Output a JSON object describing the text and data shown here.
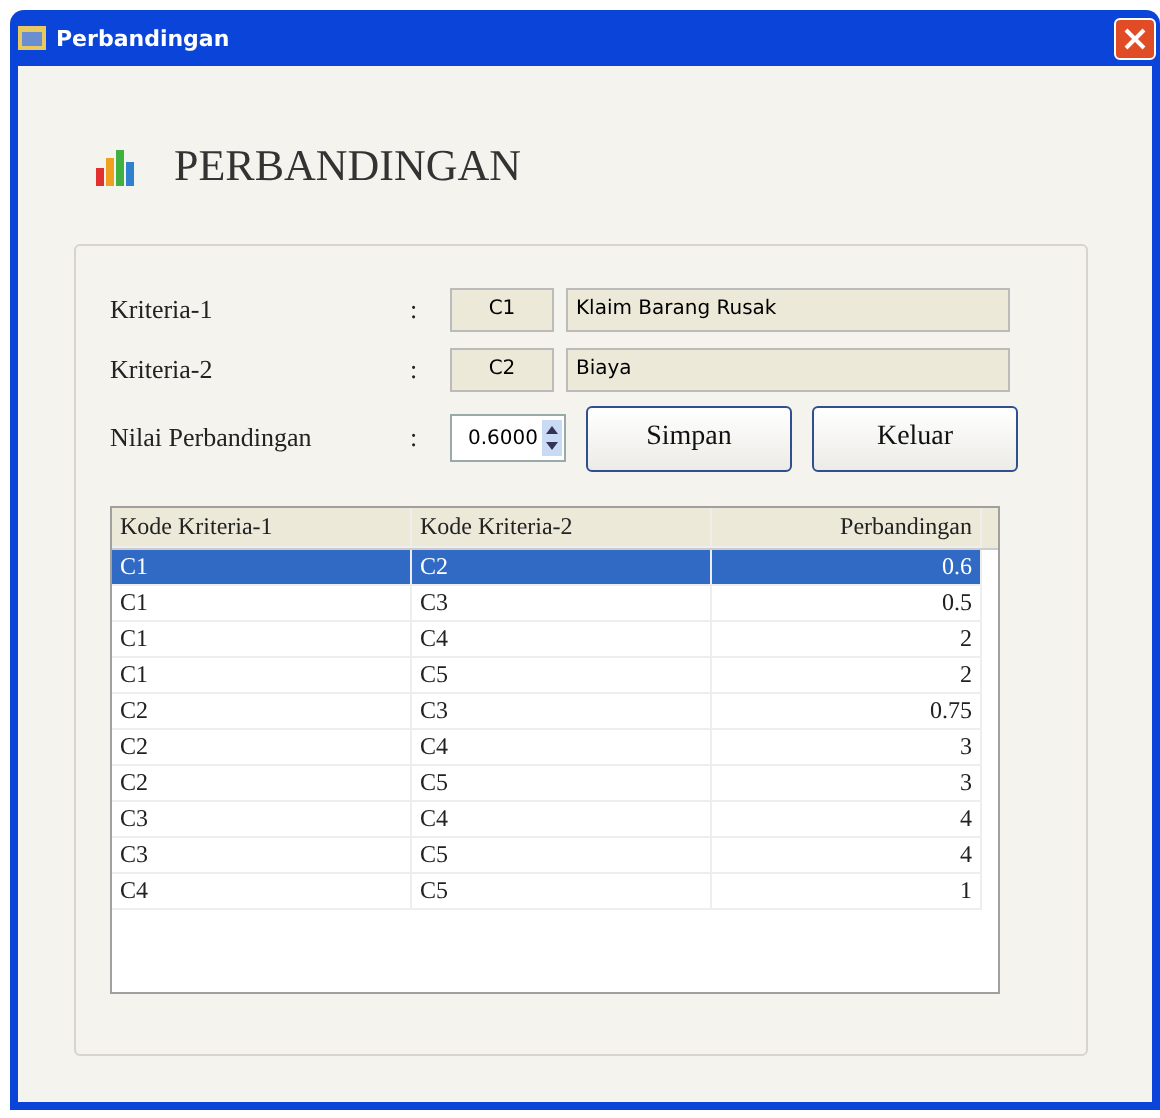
{
  "window": {
    "title": "Perbandingan"
  },
  "heading": "PERBANDINGAN",
  "form": {
    "fields": [
      {
        "label": "Kriteria-1",
        "separator": ":",
        "code": "C1",
        "name": "Klaim Barang Rusak"
      },
      {
        "label": "Kriteria-2",
        "separator": ":",
        "code": "C2",
        "name": "Biaya"
      }
    ],
    "value_label": "Nilai Perbandingan",
    "value_separator": ":",
    "value": "0.6000",
    "buttons": [
      "Simpan",
      "Keluar"
    ]
  },
  "table": {
    "columns": [
      "Kode Kriteria-1",
      "Kode Kriteria-2",
      "Perbandingan"
    ],
    "rows": [
      {
        "cells": [
          "C1",
          "C2",
          "0.6"
        ],
        "selected": true
      },
      {
        "cells": [
          "C1",
          "C3",
          "0.5"
        ],
        "selected": false
      },
      {
        "cells": [
          "C1",
          "C4",
          "2"
        ],
        "selected": false
      },
      {
        "cells": [
          "C1",
          "C5",
          "2"
        ],
        "selected": false
      },
      {
        "cells": [
          "C2",
          "C3",
          "0.75"
        ],
        "selected": false
      },
      {
        "cells": [
          "C2",
          "C4",
          "3"
        ],
        "selected": false
      },
      {
        "cells": [
          "C2",
          "C5",
          "3"
        ],
        "selected": false
      },
      {
        "cells": [
          "C3",
          "C4",
          "4"
        ],
        "selected": false
      },
      {
        "cells": [
          "C3",
          "C5",
          "4"
        ],
        "selected": false
      },
      {
        "cells": [
          "C4",
          "C5",
          "1"
        ],
        "selected": false
      }
    ]
  }
}
